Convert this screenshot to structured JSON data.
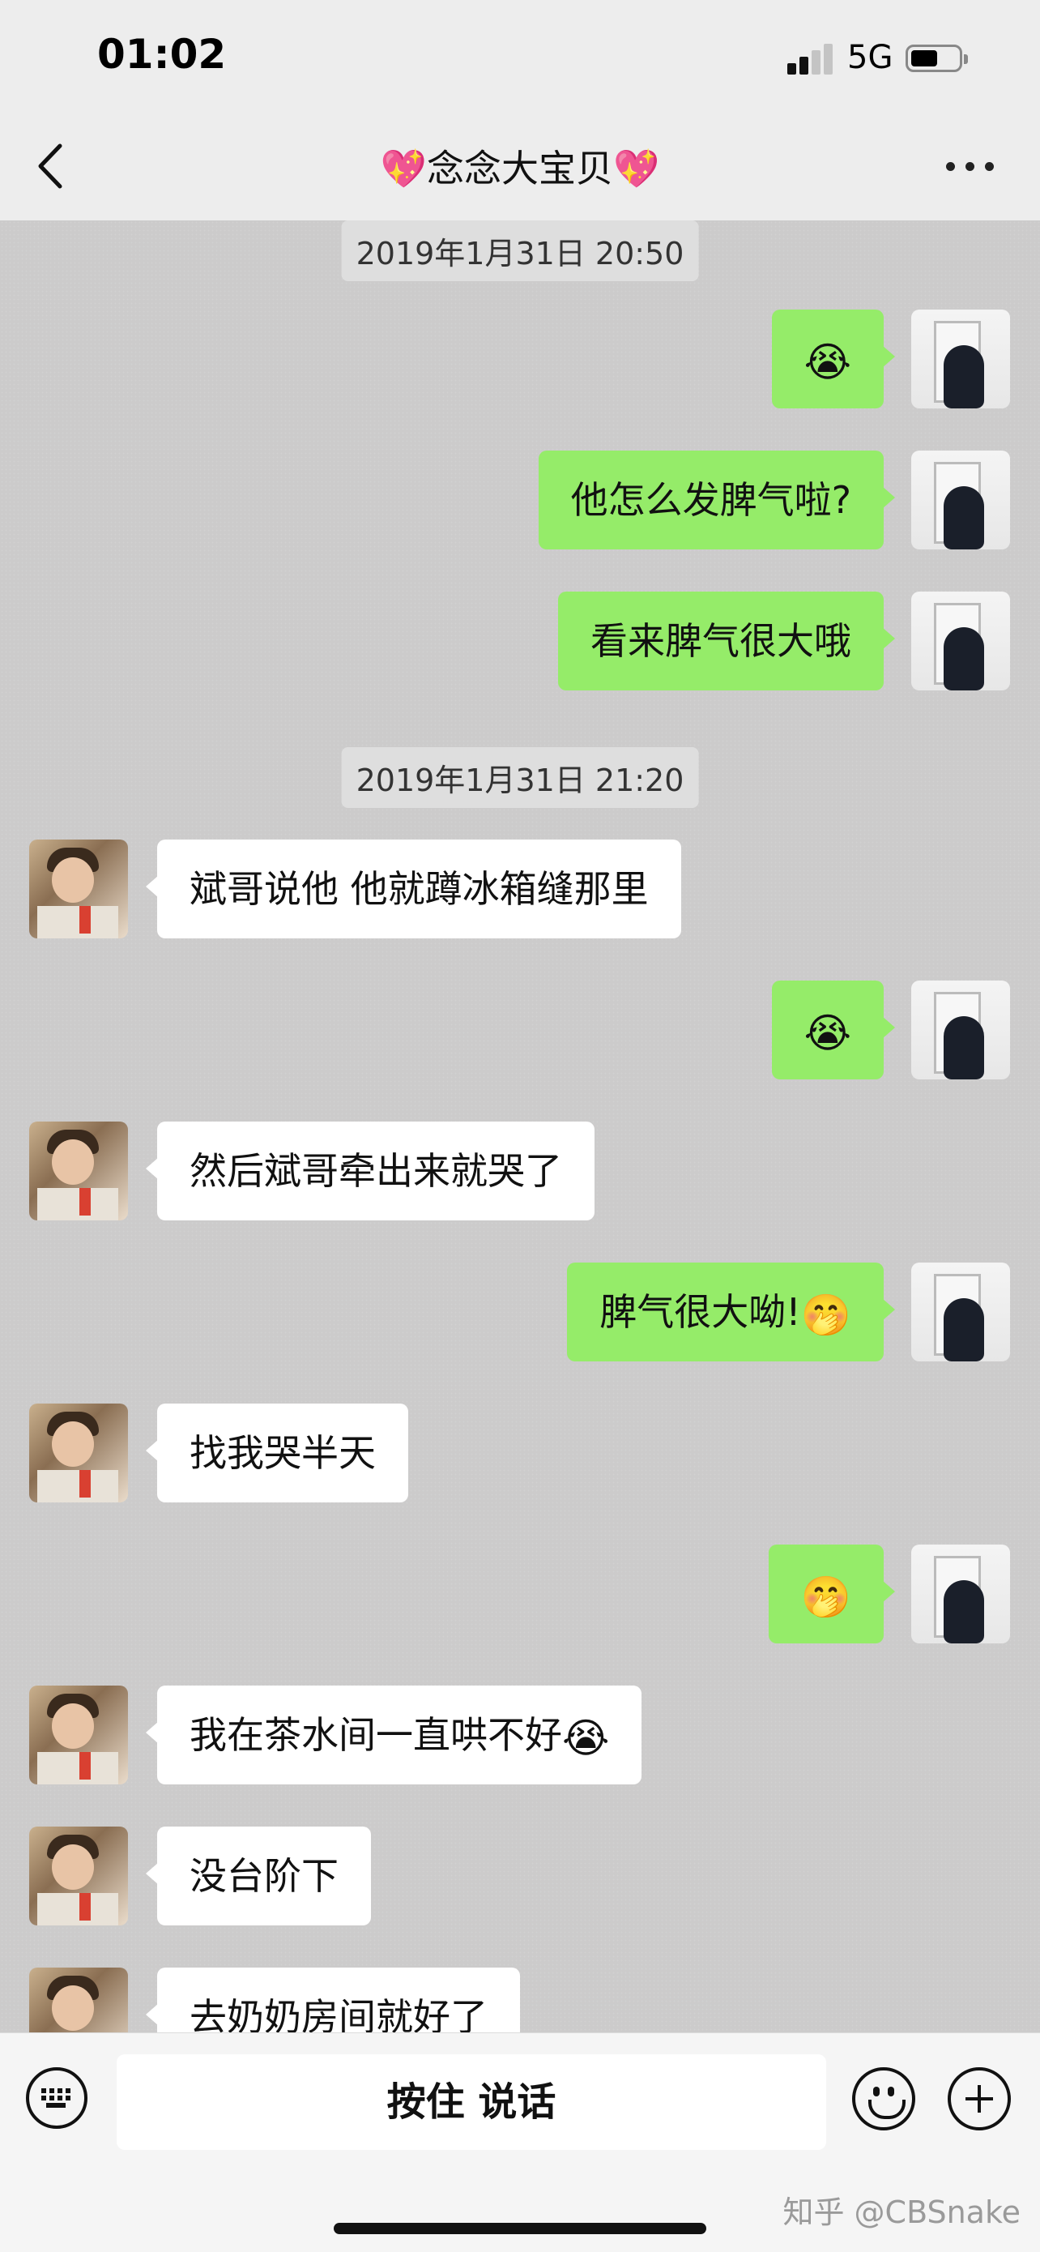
{
  "status_bar": {
    "time": "01:02",
    "network": "5G",
    "signal_level": "2/4"
  },
  "nav": {
    "title": "念念大宝贝",
    "title_emoji": "💖"
  },
  "messages": [
    {
      "type": "stamp",
      "text": "2019年1月31日 20:50"
    },
    {
      "type": "me",
      "text": "",
      "emoji": "😭"
    },
    {
      "type": "me",
      "text": "他怎么发脾气啦?",
      "emoji": ""
    },
    {
      "type": "me",
      "text": "看来脾气很大哦",
      "emoji": ""
    },
    {
      "type": "stamp",
      "text": "2019年1月31日 21:20"
    },
    {
      "type": "other",
      "text": "斌哥说他 他就蹲冰箱缝那里",
      "emoji": ""
    },
    {
      "type": "me",
      "text": "",
      "emoji": "😭"
    },
    {
      "type": "other",
      "text": "然后斌哥牵出来就哭了",
      "emoji": ""
    },
    {
      "type": "me",
      "text": "脾气很大呦!",
      "emoji": "🤭"
    },
    {
      "type": "other",
      "text": "找我哭半天",
      "emoji": ""
    },
    {
      "type": "me",
      "text": "",
      "emoji": "🤭"
    },
    {
      "type": "other",
      "text": "我在茶水间一直哄不好",
      "emoji": "😭"
    },
    {
      "type": "other",
      "text": "没台阶下",
      "emoji": ""
    },
    {
      "type": "other",
      "text": "去奶奶房间就好了",
      "emoji": ""
    }
  ],
  "input_bar": {
    "talk_label": "按住 说话"
  },
  "watermark": "知乎 @CBSnake"
}
